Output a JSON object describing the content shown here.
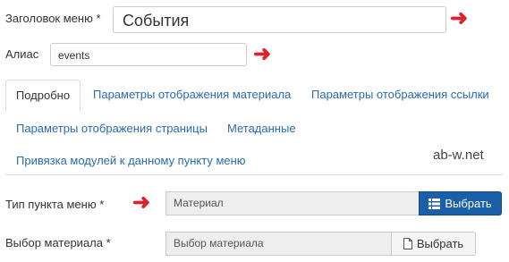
{
  "form": {
    "title_label": "Заголовок меню *",
    "title_value": "События",
    "alias_label": "Алиас",
    "alias_value": "events"
  },
  "tabs": [
    {
      "label": "Подробно"
    },
    {
      "label": "Параметры отображения материала"
    },
    {
      "label": "Параметры отображения ссылки"
    },
    {
      "label": "Параметры отображения страницы"
    },
    {
      "label": "Метаданные"
    },
    {
      "label": "Привязка модулей к данному пункту меню"
    }
  ],
  "watermark": "ab-w.net",
  "menu_type": {
    "label": "Тип пункта меню *",
    "value": "Материал",
    "button_label": "Выбрать",
    "button_icon": "list-icon"
  },
  "article_select": {
    "label": "Выбор материала *",
    "value": "Выбор материала",
    "button_label": "Выбрать",
    "button_icon": "file-icon"
  },
  "colors": {
    "accent_arrow": "#d9232d",
    "link": "#2a6ab0",
    "primary_button": "#1a5fa8"
  }
}
